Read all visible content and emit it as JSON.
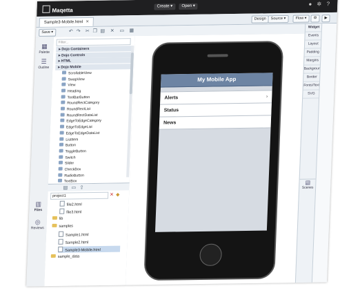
{
  "app": {
    "name": "Maqetta"
  },
  "top_menu": {
    "create": "Create",
    "open": "Open"
  },
  "top_icons": {
    "user": "user-icon",
    "settings": "gear-icon",
    "help": "help-icon"
  },
  "editor": {
    "tab_label": "Sample3-Mobile.html",
    "views": {
      "design": "Design",
      "source": "Source",
      "flow": "Flow"
    }
  },
  "toolbar": {
    "save_label": "Save"
  },
  "left_tabs": {
    "palette": "Palette",
    "outline": "Outline",
    "files": "Files",
    "reviews": "Reviews"
  },
  "palette": {
    "filter_placeholder": "Filter...",
    "items": [
      {
        "label": "Dojo Containers",
        "category": true
      },
      {
        "label": "Dojo Controls",
        "category": true
      },
      {
        "label": "HTML",
        "category": true
      },
      {
        "label": "Dojo Mobile",
        "category": true
      },
      {
        "label": "ScrollableView",
        "category": false
      },
      {
        "label": "SwapView",
        "category": false
      },
      {
        "label": "View",
        "category": false
      },
      {
        "label": "Heading",
        "category": false
      },
      {
        "label": "ToolBarButton",
        "category": false
      },
      {
        "label": "RoundRectCategory",
        "category": false
      },
      {
        "label": "RoundRectList",
        "category": false
      },
      {
        "label": "RoundRectDataList",
        "category": false
      },
      {
        "label": "EdgeToEdgeCategory",
        "category": false
      },
      {
        "label": "EdgeToEdgeList",
        "category": false
      },
      {
        "label": "EdgeToEdgeDataList",
        "category": false
      },
      {
        "label": "ListItem",
        "category": false
      },
      {
        "label": "Button",
        "category": false
      },
      {
        "label": "ToggleButton",
        "category": false
      },
      {
        "label": "Switch",
        "category": false
      },
      {
        "label": "Slider",
        "category": false
      },
      {
        "label": "CheckBox",
        "category": false
      },
      {
        "label": "RadioButton",
        "category": false
      },
      {
        "label": "TextBox",
        "category": false
      }
    ]
  },
  "files": {
    "project": "project1",
    "items": [
      {
        "label": "file2.html",
        "type": "file",
        "indent": 1,
        "selected": false
      },
      {
        "label": "file3.html",
        "type": "file",
        "indent": 1,
        "selected": false
      },
      {
        "label": "lib",
        "type": "folder",
        "indent": 0,
        "selected": false
      },
      {
        "label": "samples",
        "type": "folder",
        "indent": 0,
        "selected": false
      },
      {
        "label": "Sample1.html",
        "type": "file",
        "indent": 1,
        "selected": false
      },
      {
        "label": "Sample2.html",
        "type": "file",
        "indent": 1,
        "selected": false
      },
      {
        "label": "Sample3-Mobile.html",
        "type": "file",
        "indent": 1,
        "selected": true
      },
      {
        "label": "sample_data",
        "type": "folder",
        "indent": 0,
        "selected": false
      }
    ]
  },
  "mobile_app": {
    "title": "My Mobile App",
    "items": [
      "Alerts",
      "Status",
      "News"
    ]
  },
  "properties": {
    "tabs": [
      "Widget",
      "Events",
      "Layout",
      "Padding",
      "Margins",
      "Background",
      "Border",
      "Fonts/Text",
      "SVG"
    ],
    "scenes": "Scenes"
  }
}
